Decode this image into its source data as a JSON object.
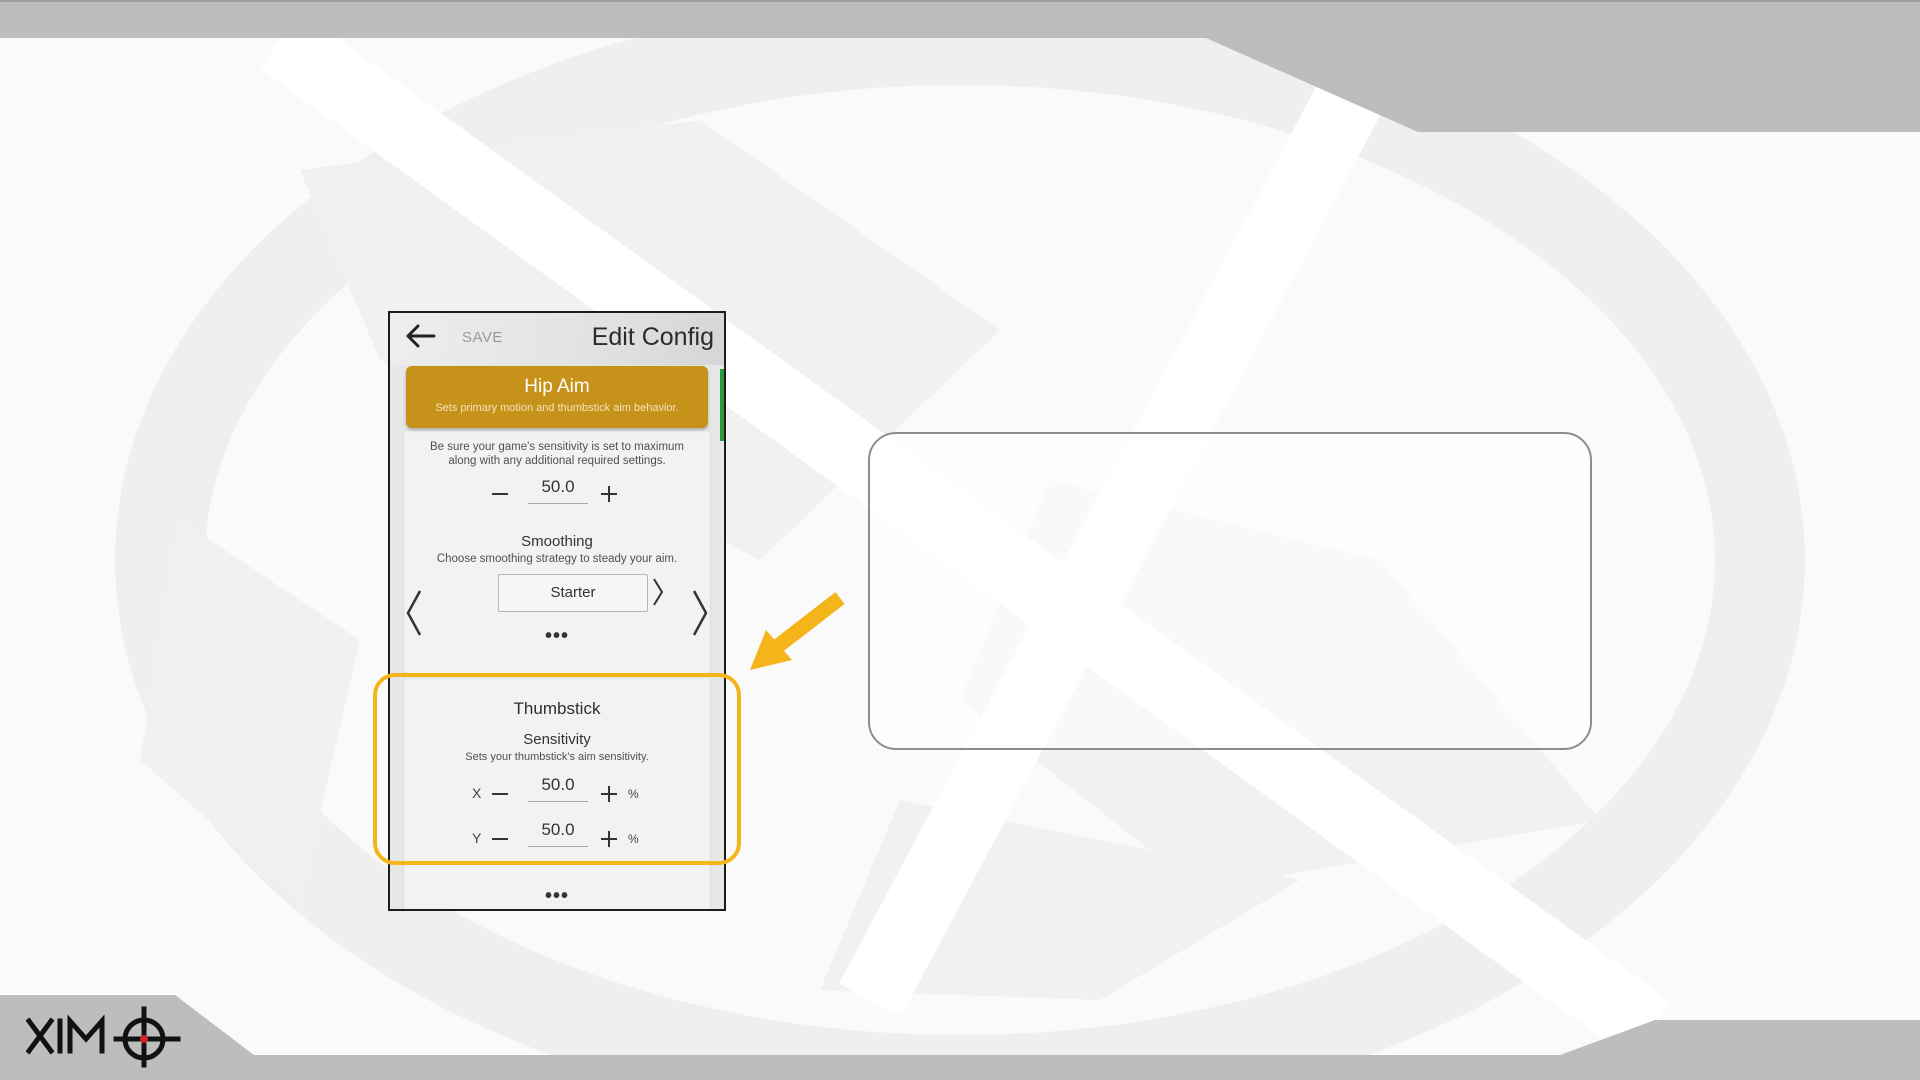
{
  "brand": {
    "logo_text": "XIMO",
    "colors": {
      "accent_gold": "#c6921a",
      "highlight_yellow": "#f3b519",
      "frame_grey": "#bdbdbd",
      "green_tab": "#2e9a3e",
      "crosshair_red": "#d6202a"
    }
  },
  "app": {
    "back_icon": "arrow-left-icon",
    "save_label": "SAVE",
    "title": "Edit Config"
  },
  "hip_aim": {
    "title": "Hip Aim",
    "subtitle": "Sets primary motion and thumbstick aim behavior."
  },
  "motion": {
    "warning_line1": "Be sure your game's sensitivity is set to maximum",
    "warning_line2": "along with any additional required settings.",
    "value": "50.0"
  },
  "smoothing": {
    "title": "Smoothing",
    "subtitle": "Choose smoothing strategy to steady your aim.",
    "selected": "Starter",
    "more": "•••"
  },
  "thumbstick": {
    "title": "Thumbstick",
    "sensitivity_title": "Sensitivity",
    "sensitivity_subtitle": "Sets your thumbstick's aim sensitivity.",
    "x_label": "X",
    "x_value": "50.0",
    "y_label": "Y",
    "y_value": "50.0",
    "unit": "%",
    "more": "•••"
  },
  "icons": [
    "arrow-left-icon",
    "chevron-left-icon",
    "chevron-right-icon",
    "minus-icon",
    "plus-icon",
    "pointer-arrow-icon",
    "crosshair-icon"
  ]
}
